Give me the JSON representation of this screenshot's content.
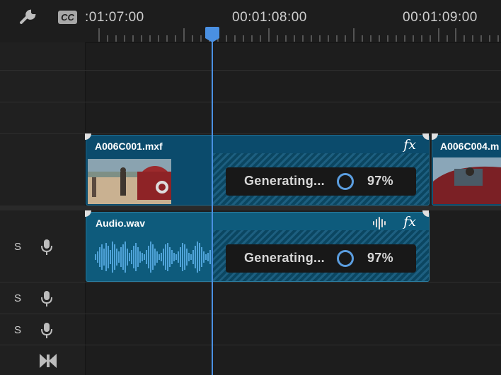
{
  "ruler": {
    "timecodes": [
      ":01:07:00",
      "00:01:08:00",
      "00:01:09:00"
    ],
    "cc_label": "CC"
  },
  "tracks": {
    "audio_rows": [
      {
        "solo_label": "S",
        "mic": "microphone-icon"
      },
      {
        "solo_label": "S",
        "mic": "microphone-icon"
      },
      {
        "solo_label": "S",
        "mic": "microphone-icon"
      }
    ]
  },
  "clips": {
    "video1": {
      "name": "A006C001.mxf",
      "fx": "fx"
    },
    "video2": {
      "name": "A006C004.m"
    },
    "audio1": {
      "name": "Audio.wav",
      "fx": "fx"
    }
  },
  "generating": {
    "video": {
      "label": "Generating...",
      "percent": "97%",
      "progress": 0.97
    },
    "audio": {
      "label": "Generating...",
      "percent": "97%",
      "progress": 0.97
    }
  },
  "colors": {
    "playhead": "#4a90e2",
    "clip_fill": "#0b4b6c",
    "waveform": "#4fa3d9"
  }
}
